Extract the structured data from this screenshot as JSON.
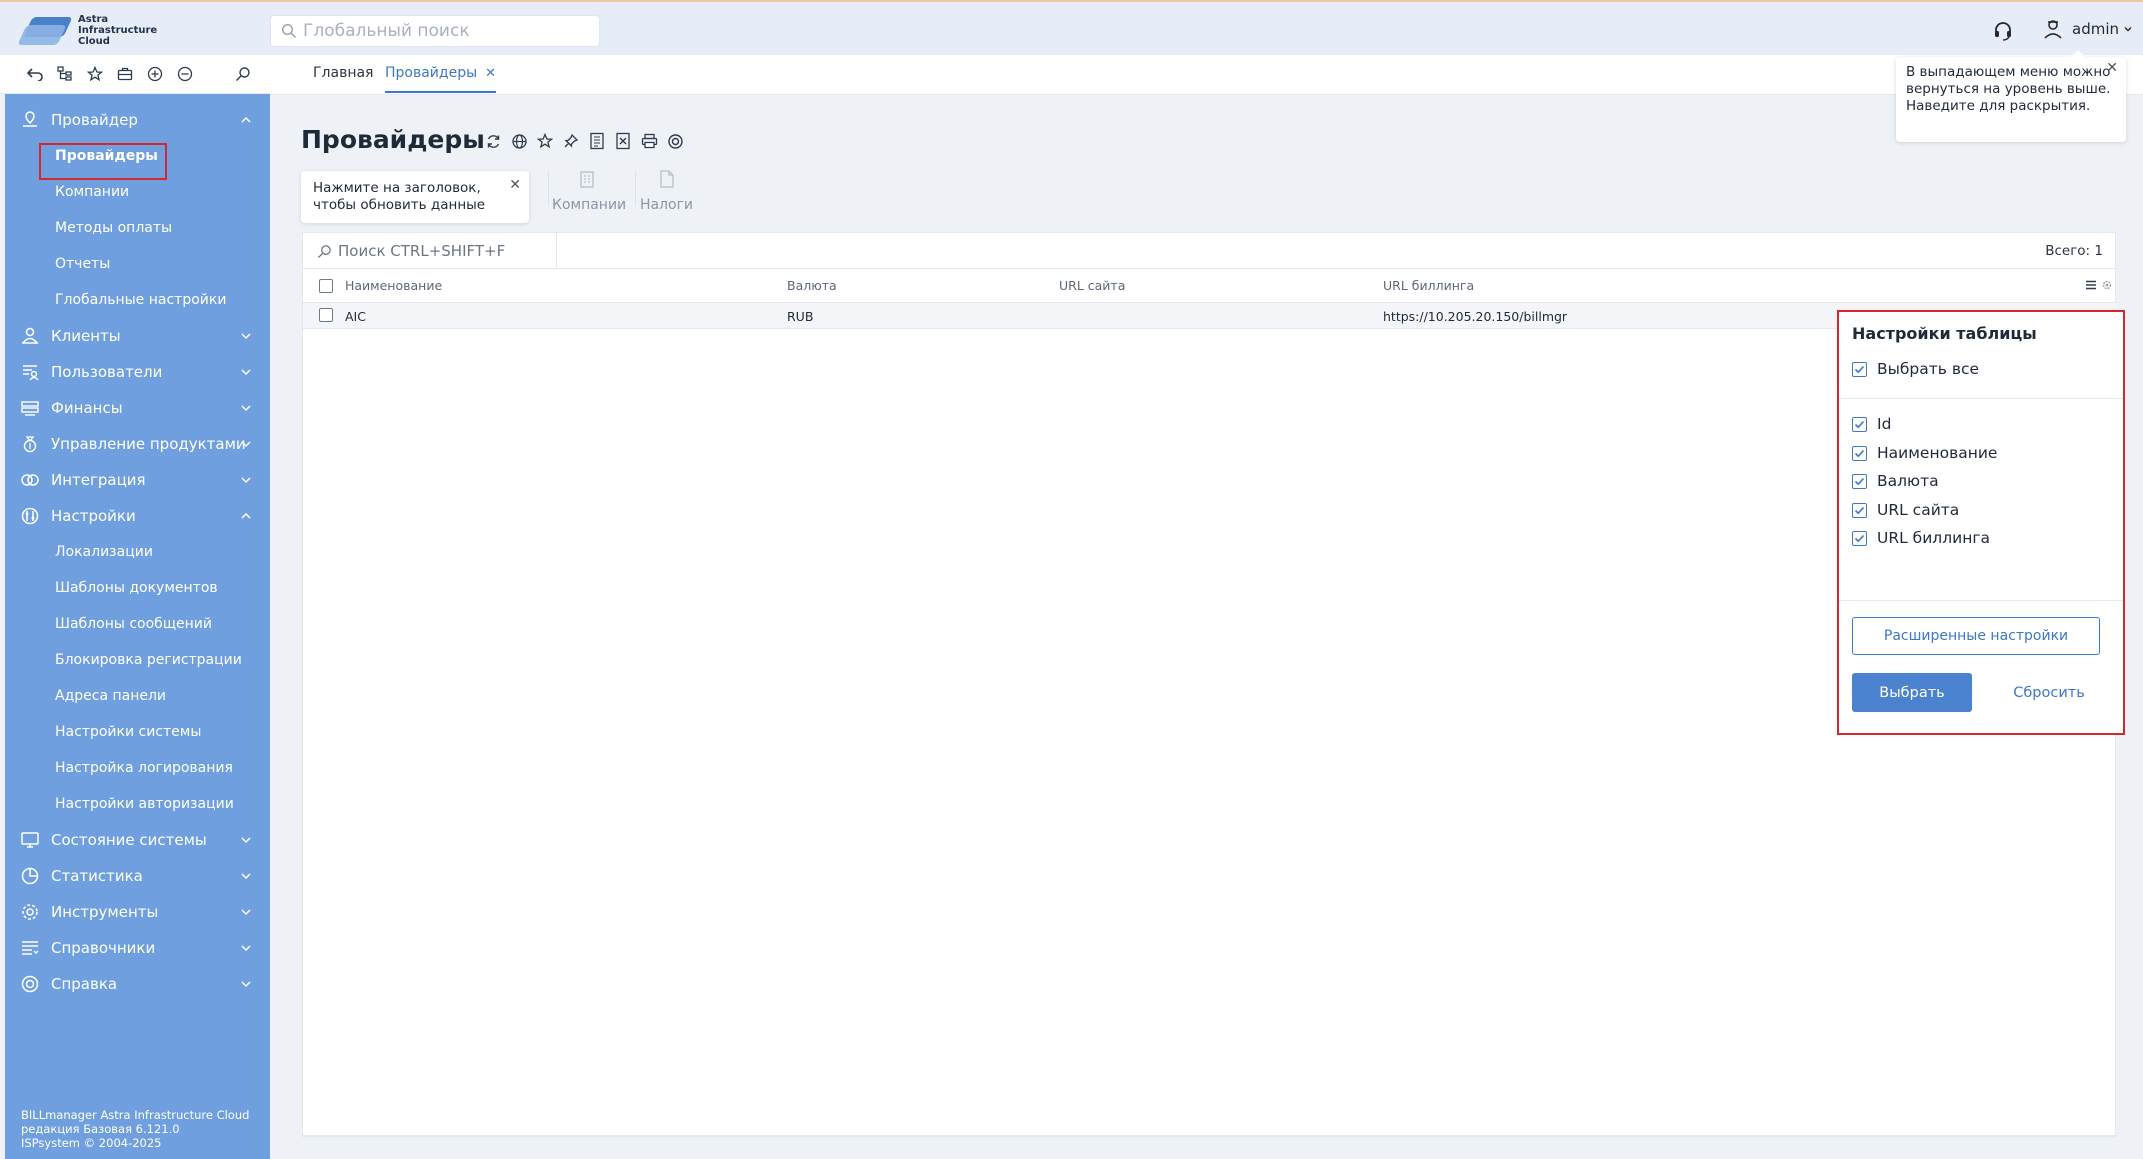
{
  "app": {
    "logo_text": "Astra\nInfrastructure\nCloud",
    "search_placeholder": "Глобальный поиск",
    "user_name": "admin"
  },
  "tabs": {
    "home": "Главная",
    "providers": "Провайдеры",
    "close_glyph": "✕"
  },
  "sidebar": {
    "groups": [
      {
        "label": "Провайдер",
        "icon": "provider-icon",
        "expanded": true,
        "items": [
          "Провайдеры",
          "Компании",
          "Методы оплаты",
          "Отчеты",
          "Глобальные настройки"
        ]
      },
      {
        "label": "Клиенты",
        "icon": "clients-icon",
        "expanded": false
      },
      {
        "label": "Пользователи",
        "icon": "users-icon",
        "expanded": false
      },
      {
        "label": "Финансы",
        "icon": "finance-icon",
        "expanded": false
      },
      {
        "label": "Управление продуктами",
        "icon": "products-icon",
        "expanded": false
      },
      {
        "label": "Интеграция",
        "icon": "integration-icon",
        "expanded": false
      },
      {
        "label": "Настройки",
        "icon": "settings-icon",
        "expanded": true,
        "items": [
          "Локализации",
          "Шаблоны документов",
          "Шаблоны сообщений",
          "Блокировка регистрации",
          "Адреса панели",
          "Настройки системы",
          "Настройка логирования",
          "Настройки авторизации"
        ]
      },
      {
        "label": "Состояние системы",
        "icon": "monitor-icon",
        "expanded": false
      },
      {
        "label": "Статистика",
        "icon": "statistics-icon",
        "expanded": false
      },
      {
        "label": "Инструменты",
        "icon": "tools-icon",
        "expanded": false
      },
      {
        "label": "Справочники",
        "icon": "directories-icon",
        "expanded": false
      },
      {
        "label": "Справка",
        "icon": "help-icon",
        "expanded": false
      }
    ],
    "footer": [
      "BILLmanager Astra Infrastructure Cloud",
      "редакция Базовая 6.121.0",
      "ISPsystem © 2004-2025"
    ]
  },
  "page": {
    "title": "Провайдеры",
    "hint_left": "Нажмите на заголовок, чтобы обновить данные",
    "actions": {
      "companies": "Компании",
      "taxes": "Налоги"
    },
    "hint_right": "В выпадающем меню можно вернуться на уровень выше. Наведите для раскрытия."
  },
  "table": {
    "search_placeholder": "Поиск CTRL+SHIFT+F",
    "total": "Всего: 1",
    "columns": [
      "Наименование",
      "Валюта",
      "URL сайта",
      "URL биллинга"
    ],
    "rows": [
      {
        "name": "AIC",
        "currency": "RUB",
        "site_url": "",
        "billing_url": "https://10.205.20.150/billmgr"
      }
    ]
  },
  "table_settings": {
    "title": "Настройки таблицы",
    "select_all": "Выбрать все",
    "columns": [
      "Id",
      "Наименование",
      "Валюта",
      "URL сайта",
      "URL биллинга"
    ],
    "advanced_button": "Расширенные настройки",
    "select_button": "Выбрать",
    "reset_button": "Сбросить"
  }
}
